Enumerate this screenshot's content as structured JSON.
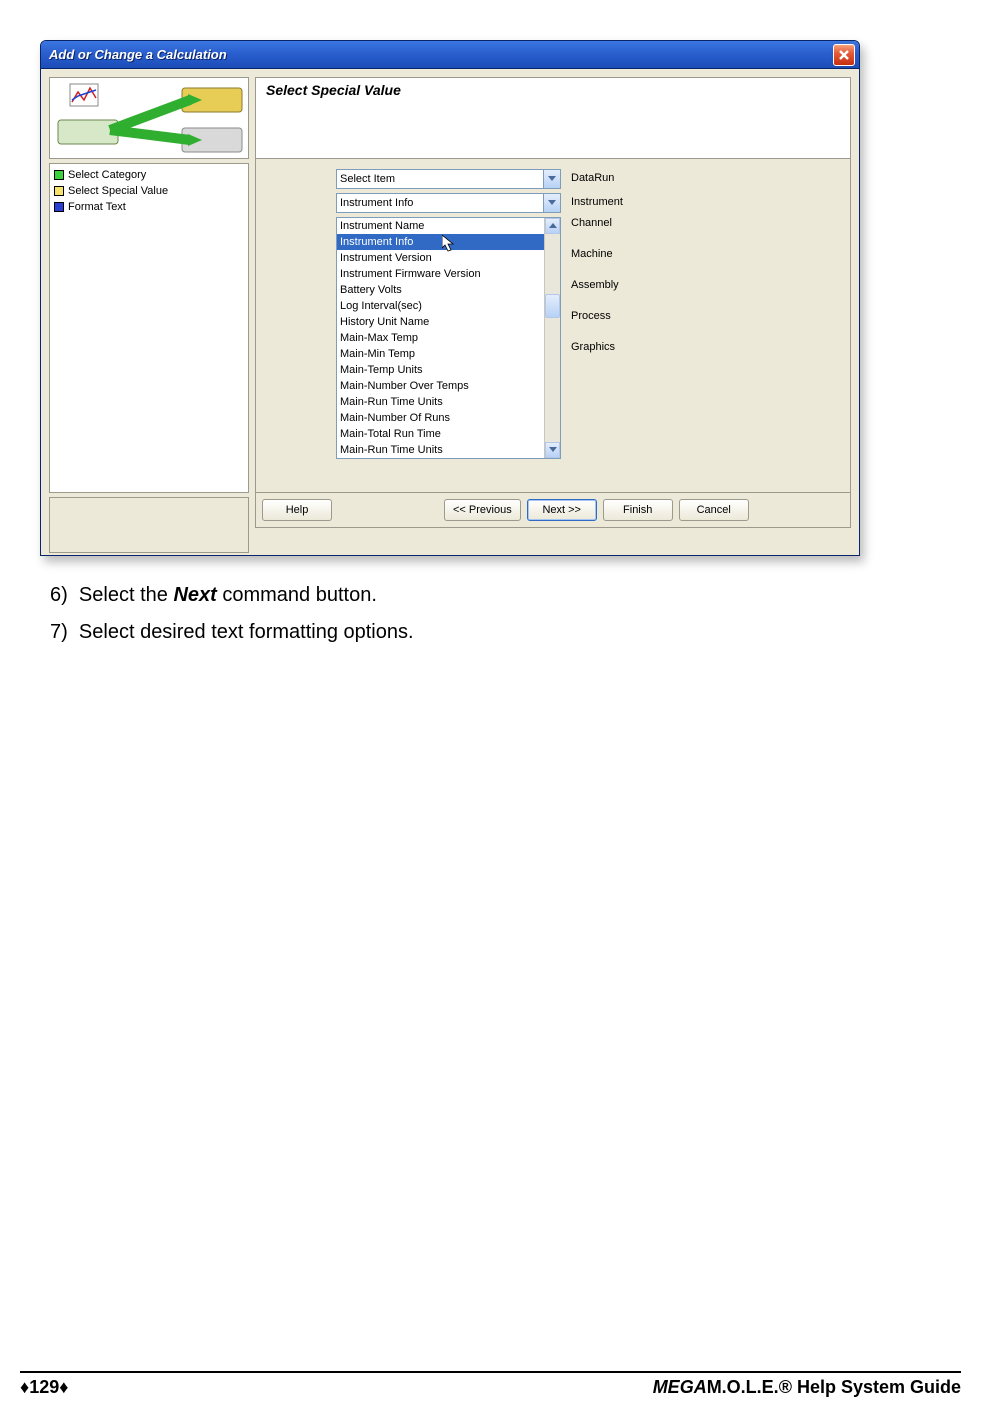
{
  "window": {
    "title": "Add or Change a Calculation",
    "heading": "Select Special Value",
    "steps": [
      {
        "color": "#3bd23b",
        "label": "Select Category"
      },
      {
        "color": "#f7e36b",
        "label": "Select Special Value"
      },
      {
        "color": "#2a3fd1",
        "label": "Format Text"
      }
    ],
    "combo1": {
      "value": "Select Item",
      "label": "DataRun"
    },
    "combo2": {
      "value": "Instrument Info",
      "label": "Instrument"
    },
    "listbox": {
      "items": [
        "Instrument Name",
        "Instrument Info",
        "Instrument Version",
        "Instrument Firmware Version",
        "Battery Volts",
        "Log Interval(sec)",
        "History Unit Name",
        "Main-Max Temp",
        "Main-Min Temp",
        "Main-Temp Units",
        "Main-Number Over Temps",
        "Main-Run Time Units",
        "Main-Number Of Runs",
        "Main-Total Run Time",
        "Main-Run Time Units"
      ],
      "selected_index": 1
    },
    "side_labels": [
      "Channel",
      "Machine",
      "Assembly",
      "Process",
      "Graphics"
    ],
    "buttons": {
      "help": "Help",
      "prev": "<< Previous",
      "next": "Next >>",
      "finish": "Finish",
      "cancel": "Cancel"
    }
  },
  "instructions": {
    "step6_num": "6)",
    "step6_a": "Select the ",
    "step6_b": "Next",
    "step6_c": " command button.",
    "step7_num": "7)",
    "step7": "Select desired text formatting options."
  },
  "footer": {
    "page": "129",
    "guide_prefix": "MEGA",
    "guide_suffix": "M.O.L.E.® Help System Guide"
  }
}
